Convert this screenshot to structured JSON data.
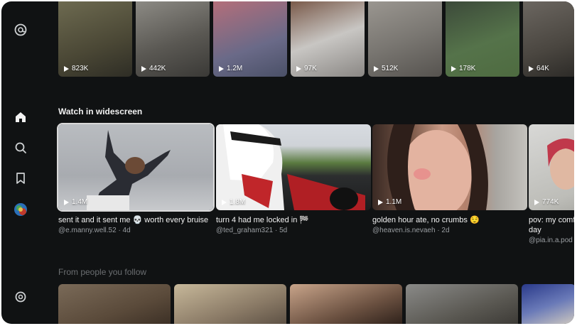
{
  "top_row": [
    {
      "views": "823K"
    },
    {
      "views": "442K"
    },
    {
      "views": "1.2M"
    },
    {
      "views": "97K"
    },
    {
      "views": "512K"
    },
    {
      "views": "178K"
    },
    {
      "views": "64K"
    }
  ],
  "sections": {
    "widescreen_title": "Watch in widescreen",
    "following_title": "From people you follow"
  },
  "widescreen": [
    {
      "views": "1.4M",
      "caption": "sent it and it sent me 💀 worth every bruise",
      "handle": "@e.manny.well.52 · 4d"
    },
    {
      "views": "1.8M",
      "caption": "turn 4 had me locked in 🏁",
      "handle": "@ted_graham321 · 5d"
    },
    {
      "views": "1.1M",
      "caption": "golden hour ate, no crumbs 😌",
      "handle": "@heaven.is.nevaeh · 2d"
    },
    {
      "views": "774K",
      "caption": "pov: my comfo",
      "caption2": "day",
      "handle": "@pia.in.a.pod ·"
    }
  ],
  "sidebar": {
    "icons": [
      "threads-logo-icon",
      "home-icon",
      "search-icon",
      "bookmark-icon",
      "avatar-icon",
      "settings-icon"
    ]
  }
}
